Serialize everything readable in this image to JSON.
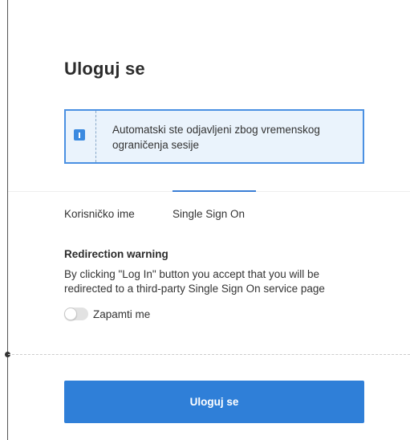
{
  "title": "Uloguj se",
  "alert": {
    "icon": "info-icon",
    "message": "Automatski ste odjavljeni zbog vremenskog ograničenja sesije"
  },
  "tabs": [
    {
      "label": "Korisničko ime",
      "active": false
    },
    {
      "label": "Single Sign On",
      "active": true
    }
  ],
  "warning": {
    "title": "Redirection warning",
    "text": "By clicking \"Log In\" button you accept that you will be redirected to a third-party Single Sign On service page"
  },
  "remember": {
    "label": "Zapamti me",
    "checked": false
  },
  "login_button": "Uloguj se",
  "colors": {
    "accent": "#2f7fd8",
    "alert_bg": "#eaf3fc",
    "alert_border": "#4a90e2"
  }
}
